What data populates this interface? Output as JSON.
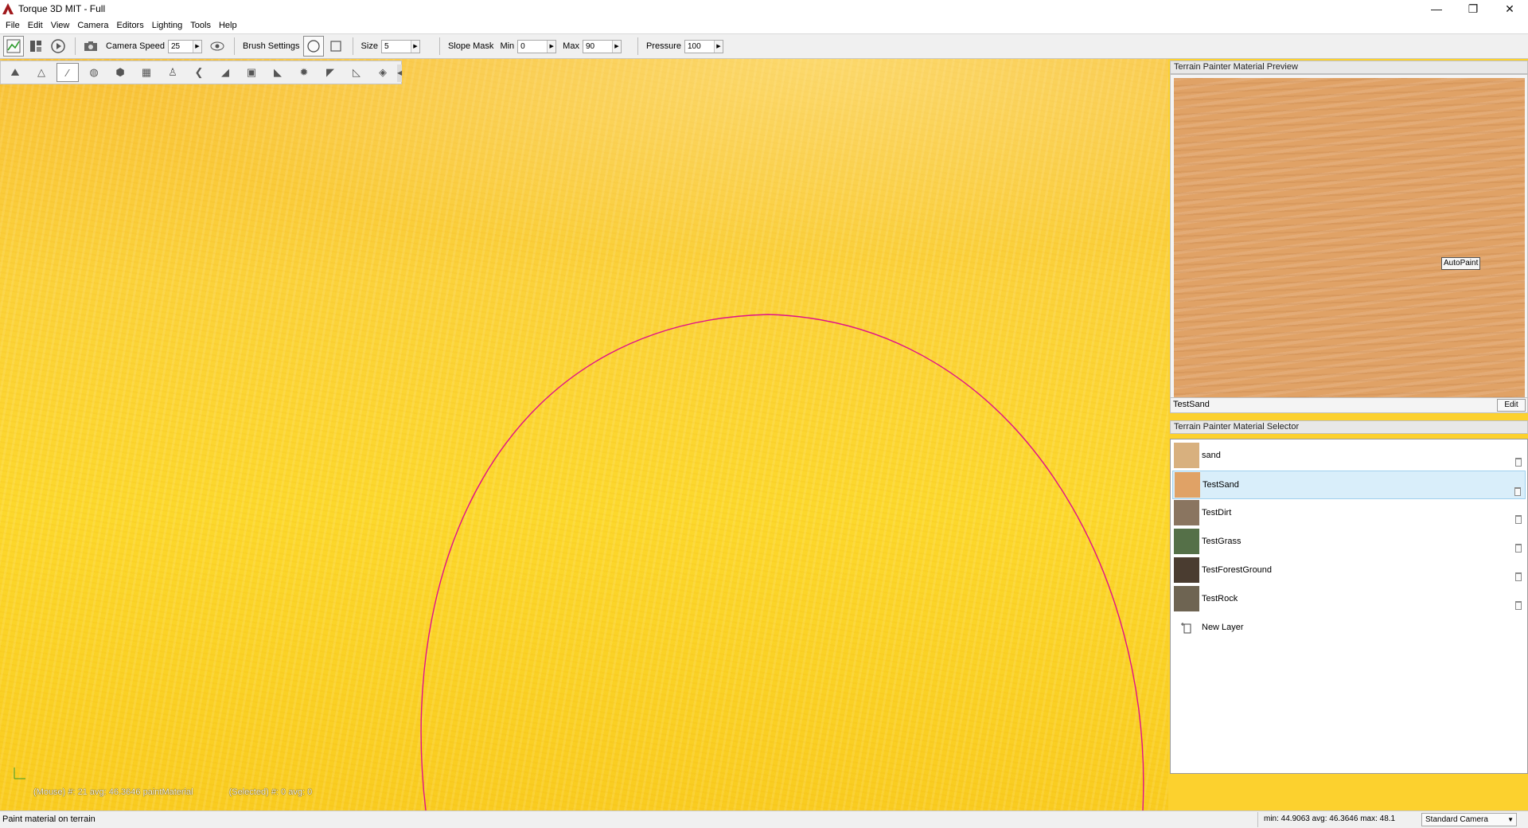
{
  "window": {
    "title": "Torque 3D MIT - Full",
    "controls": [
      "—",
      "❐",
      "✕"
    ]
  },
  "menu": [
    "File",
    "Edit",
    "View",
    "Camera",
    "Editors",
    "Lighting",
    "Tools",
    "Help"
  ],
  "toolbar": {
    "camera_speed_label": "Camera Speed",
    "camera_speed_value": "25",
    "brush_settings_label": "Brush Settings",
    "size_label": "Size",
    "size_value": "5",
    "slope_mask_label": "Slope Mask",
    "min_label": "Min",
    "min_value": "0",
    "max_label": "Max",
    "max_value": "90",
    "pressure_label": "Pressure",
    "pressure_value": "100"
  },
  "palette": {
    "tools": [
      "select-terrain-icon",
      "raise-height-icon",
      "paint-material-icon",
      "world-icon",
      "cube-icon",
      "texture-icon",
      "smooth-icon",
      "flatten-icon",
      "slope-icon",
      "adjust-height-icon",
      "noise-icon",
      "erode-icon",
      "set-height-icon",
      "clear-icon",
      "terrain-options-icon"
    ],
    "active_index": 2
  },
  "viewport": {
    "mouse_info": "(Mouse) #: 21  avg: 46.3646 paintMaterial",
    "selected_info": "(Selected) #: 0  avg: 0",
    "brush_color": "#e0108a"
  },
  "preview_panel": {
    "header": "Terrain Painter Material Preview",
    "autopaint_label": "AutoPaint",
    "material_name": "TestSand",
    "edit_label": "Edit"
  },
  "selector_panel": {
    "header": "Terrain Painter Material Selector",
    "materials": [
      {
        "name": "sand",
        "color": "#d8b07e"
      },
      {
        "name": "TestSand",
        "color": "#e0a266"
      },
      {
        "name": "TestDirt",
        "color": "#8a7560"
      },
      {
        "name": "TestGrass",
        "color": "#557048"
      },
      {
        "name": "TestForestGround",
        "color": "#4a3c30"
      },
      {
        "name": "TestRock",
        "color": "#6e6452"
      }
    ],
    "selected_index": 1,
    "new_layer_label": "New Layer"
  },
  "statusbar": {
    "message": "Paint material on terrain",
    "height_stats": "min: 44.9063  avg: 46.3646  max: 48.1",
    "camera_mode": "Standard Camera"
  }
}
